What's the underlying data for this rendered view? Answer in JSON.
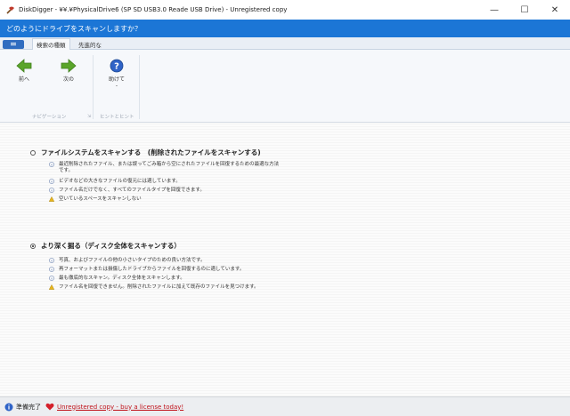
{
  "window": {
    "title": "DiskDigger - ¥¥.¥PhysicalDrive6 (SP SD  USB3.0 Reade USB Drive) - Unregistered copy",
    "minimize": "—",
    "maximize": "☐",
    "close": "✕"
  },
  "banner": {
    "text": "どのようにドライブをスキャンしますか？"
  },
  "ribbon": {
    "tabs": [
      {
        "label": "検索の種類",
        "active": true
      },
      {
        "label": "先進的な",
        "active": false
      }
    ],
    "buttons": {
      "back": "前へ",
      "next": "次の",
      "help": "助けて",
      "help_more": "-"
    },
    "groups": {
      "navigation": "ナビゲーション",
      "hints": "ヒントとヒント"
    }
  },
  "options": [
    {
      "label": "ファイルシステムをスキャンする　(削除されたファイルをスキャンする)",
      "selected": false,
      "bullets": [
        {
          "type": "info",
          "text": "最近削除されたファイル、または誤ってごみ箱から空にされたファイルを回復するための最適な方法です。"
        },
        {
          "type": "info",
          "text": "ビデオなどの大きなファイルの復元には適しています。"
        },
        {
          "type": "info",
          "text": "ファイル名だけでなく、すべてのファイルタイプを回復できます。"
        },
        {
          "type": "warning",
          "text": "空いているスペースをスキャンしない"
        }
      ]
    },
    {
      "label": "より深く掘る（ディスク全体をスキャンする）",
      "selected": true,
      "bullets": [
        {
          "type": "info",
          "text": "写真、およびファイルの他の小さいタイプのための良い方法です。"
        },
        {
          "type": "info",
          "text": "再フォーマットまたは損傷したドライブからファイルを回復するのに適しています。"
        },
        {
          "type": "info",
          "text": "最も徹底的なスキャン。ディスク全体をスキャンします。"
        },
        {
          "type": "warning",
          "text": "ファイル名を回復できません。削除されたファイルに加えて既存のファイルを見つけます。"
        }
      ]
    }
  ],
  "status": {
    "text": "準備完了",
    "link": "Unregistered copy - buy a license today!"
  },
  "colors": {
    "banner": "#1c76d6",
    "link": "#c0121a",
    "nav_arrow": "#5aa52a",
    "help": "#2f63c7"
  }
}
